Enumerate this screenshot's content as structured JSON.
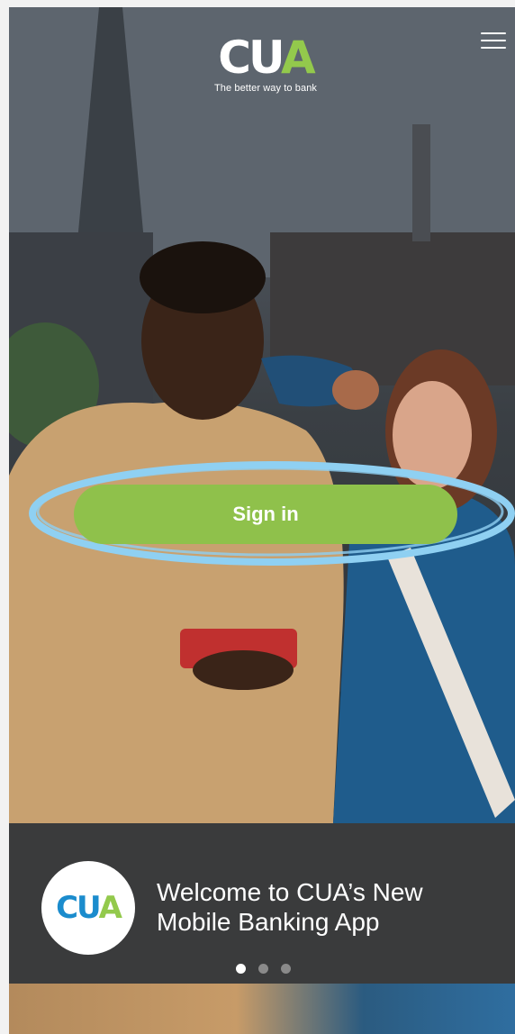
{
  "header": {
    "brand_word_main": "CU",
    "brand_word_accent": "A",
    "tagline": "The better way to bank",
    "menu_icon": "hamburger-menu-icon"
  },
  "hero": {
    "signin_label": "Sign in",
    "highlight_color": "#8fd0f2"
  },
  "welcome": {
    "logo_main": "CU",
    "logo_accent": "A",
    "line1": "Welcome to CUA’s New",
    "line2": "Mobile Banking App"
  },
  "carousel": {
    "total": 3,
    "active_index": 0
  },
  "colors": {
    "brand_green": "#8fc14b",
    "brand_blue": "#1b8ccd",
    "panel_dark": "#3a3b3c"
  }
}
